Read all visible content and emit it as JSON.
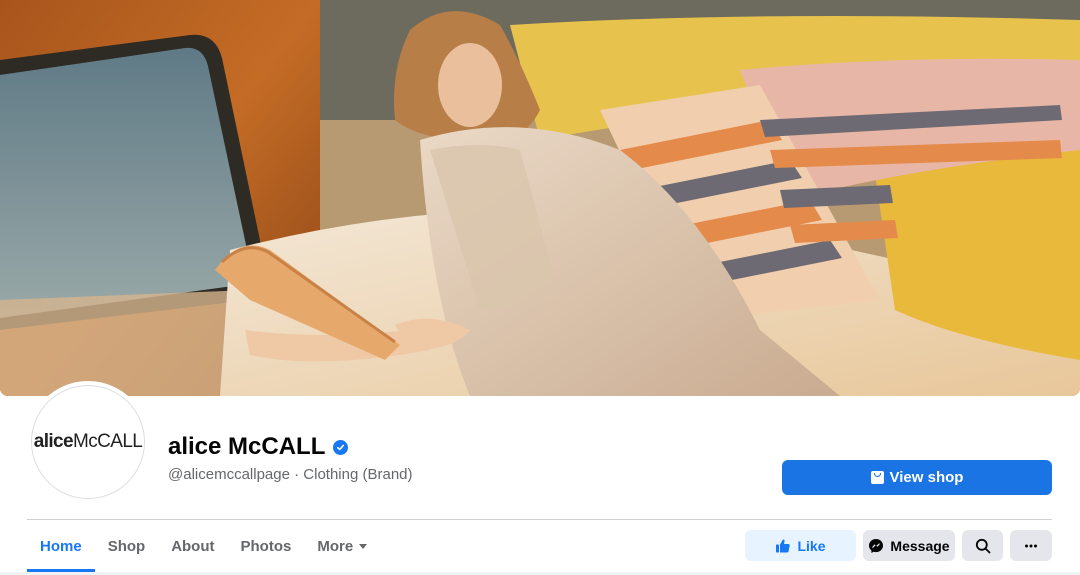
{
  "page": {
    "name": "alice McCALL",
    "verified": true,
    "subtitle": "@alicemccallpage · Clothing (Brand)",
    "avatar_logo_part1": "alice",
    "avatar_logo_part2": "McCALL"
  },
  "cover": {
    "description_icon": "cover-photo"
  },
  "actions": {
    "view_shop": "View shop",
    "like": "Like",
    "message": "Message"
  },
  "tabs": [
    {
      "label": "Home",
      "active": true
    },
    {
      "label": "Shop"
    },
    {
      "label": "About"
    },
    {
      "label": "Photos"
    },
    {
      "label": "More"
    }
  ],
  "colors": {
    "accent": "#1877f2",
    "primary_button": "#1b74e4",
    "secondary_bg": "#e4e6eb",
    "like_bg": "#e7f3ff",
    "muted_text": "#65676b"
  }
}
